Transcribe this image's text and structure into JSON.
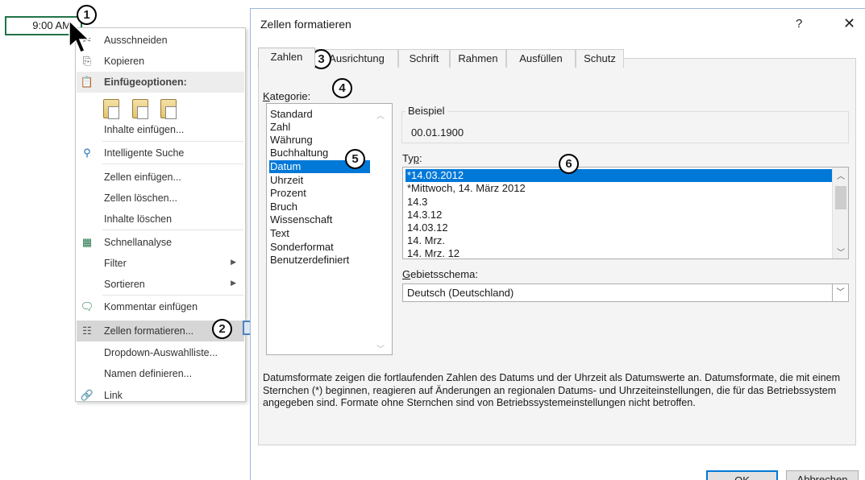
{
  "cell": {
    "value": "9:00 AM"
  },
  "context_menu": {
    "items": [
      {
        "icon": "cut-icon",
        "label": "Ausschneiden"
      },
      {
        "icon": "copy-icon",
        "label": "Kopieren"
      },
      {
        "icon": "paste-icon",
        "label": "Einfügeoptionen:"
      },
      {
        "icon": "",
        "label": "Inhalte einfügen..."
      },
      {
        "icon": "search-icon",
        "label": "Intelligente Suche"
      },
      {
        "icon": "",
        "label": "Zellen einfügen..."
      },
      {
        "icon": "",
        "label": "Zellen löschen..."
      },
      {
        "icon": "",
        "label": "Inhalte löschen"
      },
      {
        "icon": "quick-analysis-icon",
        "label": "Schnellanalyse"
      },
      {
        "icon": "",
        "label": "Filter"
      },
      {
        "icon": "",
        "label": "Sortieren"
      },
      {
        "icon": "comment-icon",
        "label": "Kommentar einfügen"
      },
      {
        "icon": "format-cells-icon",
        "label": "Zellen formatieren..."
      },
      {
        "icon": "",
        "label": "Dropdown-Auswahlliste..."
      },
      {
        "icon": "",
        "label": "Namen definieren..."
      },
      {
        "icon": "link-icon",
        "label": "Link"
      }
    ]
  },
  "callouts": [
    "1",
    "2",
    "3",
    "4",
    "5",
    "6"
  ],
  "dialog": {
    "title": "Zellen formatieren",
    "help": "?",
    "close": "✕",
    "tabs": [
      "Zahlen",
      "Ausrichtung",
      "Schrift",
      "Rahmen",
      "Ausfüllen",
      "Schutz"
    ],
    "kategorie_label": "Kategorie:",
    "kategorien": [
      "Standard",
      "Zahl",
      "Währung",
      "Buchhaltung",
      "Datum",
      "Uhrzeit",
      "Prozent",
      "Bruch",
      "Wissenschaft",
      "Text",
      "Sonderformat",
      "Benutzerdefiniert"
    ],
    "selected_kategorie": "Datum",
    "beispiel_label": "Beispiel",
    "beispiel_value": "00.01.1900",
    "typ_label": "Typ:",
    "typen": [
      "*14.03.2012",
      "*Mittwoch, 14. März 2012",
      "14.3",
      "14.3.12",
      "14.03.12",
      "14. Mrz.",
      "14. Mrz. 12"
    ],
    "selected_typ": "*14.03.2012",
    "gebietsschema_label": "Gebietsschema:",
    "gebietsschema_value": "Deutsch (Deutschland)",
    "description": "Datumsformate zeigen die fortlaufenden Zahlen des Datums und der Uhrzeit als Datumswerte an. Datumsformate, die mit einem Sternchen (*) beginnen, reagieren auf Änderungen an regionalen Datums- und Uhrzeiteinstellungen, die für das Betriebssystem angegeben sind. Formate ohne Sternchen sind von Betriebssystemeinstellungen nicht betroffen.",
    "ok_label": "OK",
    "cancel_label": "Abbrechen"
  },
  "colors": {
    "selection": "#0078d7",
    "cell_border": "#217346",
    "arrow": "#4f81bd"
  }
}
